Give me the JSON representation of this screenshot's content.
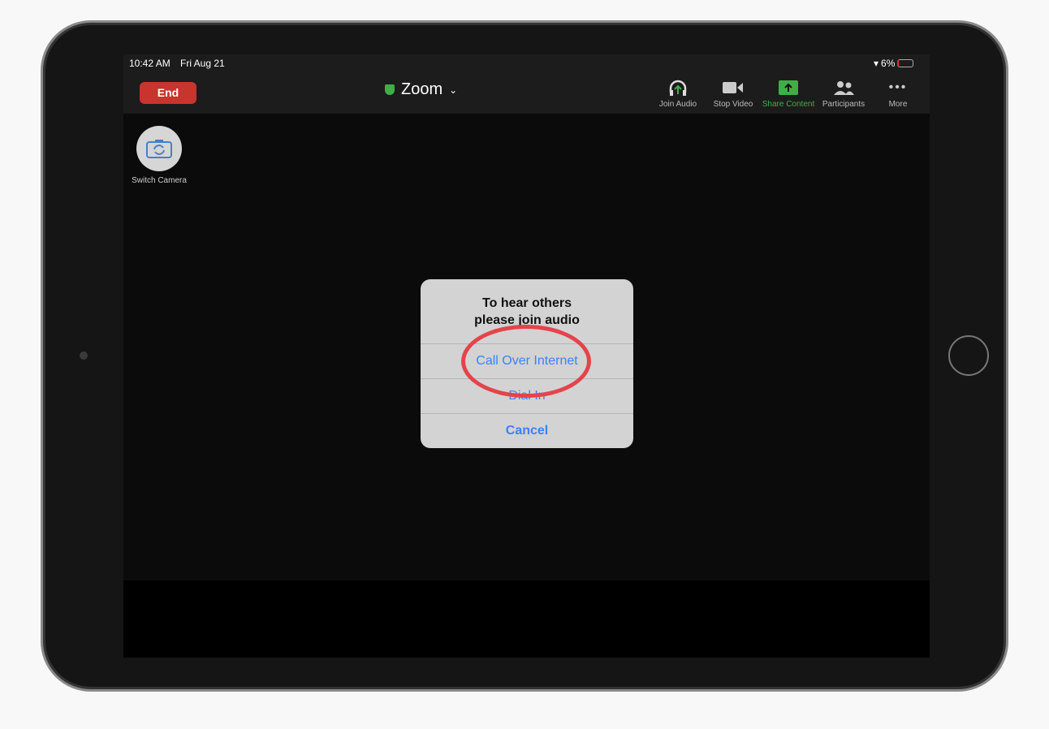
{
  "status": {
    "time": "10:42 AM",
    "date": "Fri Aug 21",
    "battery": "6%"
  },
  "header": {
    "end_label": "End",
    "title": "Zoom"
  },
  "toolbar": [
    {
      "label": "Join Audio",
      "icon": "headphones-icon"
    },
    {
      "label": "Stop Video",
      "icon": "video-camera-icon"
    },
    {
      "label": "Share Content",
      "icon": "share-up-arrow-icon"
    },
    {
      "label": "Participants",
      "icon": "participants-icon"
    },
    {
      "label": "More",
      "icon": "more-dots-icon"
    }
  ],
  "switch_camera": {
    "label": "Switch Camera"
  },
  "dialog": {
    "title_line1": "To hear others",
    "title_line2": "please join audio",
    "options": [
      "Call Over Internet",
      "Dial In",
      "Cancel"
    ]
  },
  "colors": {
    "end": "#c8352d",
    "accent_green": "#3fae49",
    "link_blue": "#3b82f6",
    "highlight_ring": "#e5434b"
  }
}
